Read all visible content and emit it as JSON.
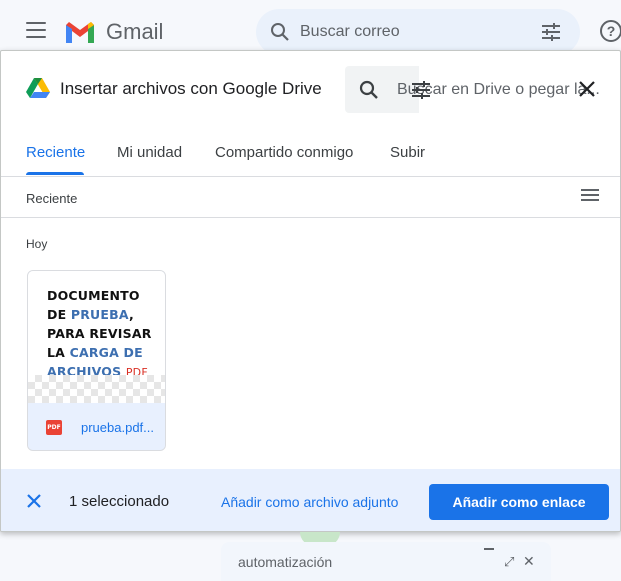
{
  "gmail": {
    "brand": "Gmail",
    "search_placeholder": "Buscar correo",
    "help": "?"
  },
  "dialog": {
    "title": "Insertar archivos con Google Drive",
    "search_placeholder": "Buscar en Drive o pegar la...",
    "tabs": [
      {
        "label": "Reciente",
        "active": true
      },
      {
        "label": "Mi unidad",
        "active": false
      },
      {
        "label": "Compartido conmigo",
        "active": false
      },
      {
        "label": "Subir",
        "active": false
      }
    ],
    "breadcrumb": "Reciente",
    "section": "Hoy",
    "file": {
      "name": "prueba.pdf...",
      "type_badge": "PDF",
      "thumb_lines": [
        "DOCUMENTO",
        "DE ",
        "PRUEBA",
        ",",
        "PARA REVISAR",
        "LA ",
        "CARGA DE",
        "ARCHIVOS ",
        "PDF"
      ]
    },
    "footer": {
      "selected": "1 seleccionado",
      "attach_label": "Añadir como archivo adjunto",
      "link_label": "Añadir como enlace"
    }
  },
  "compose": {
    "title": "automatización",
    "expand": "⤢",
    "close": "✕"
  },
  "colors": {
    "accent": "#1a73e8",
    "footer_bg": "#e8f0fe",
    "pdf_red": "#ea4335"
  }
}
